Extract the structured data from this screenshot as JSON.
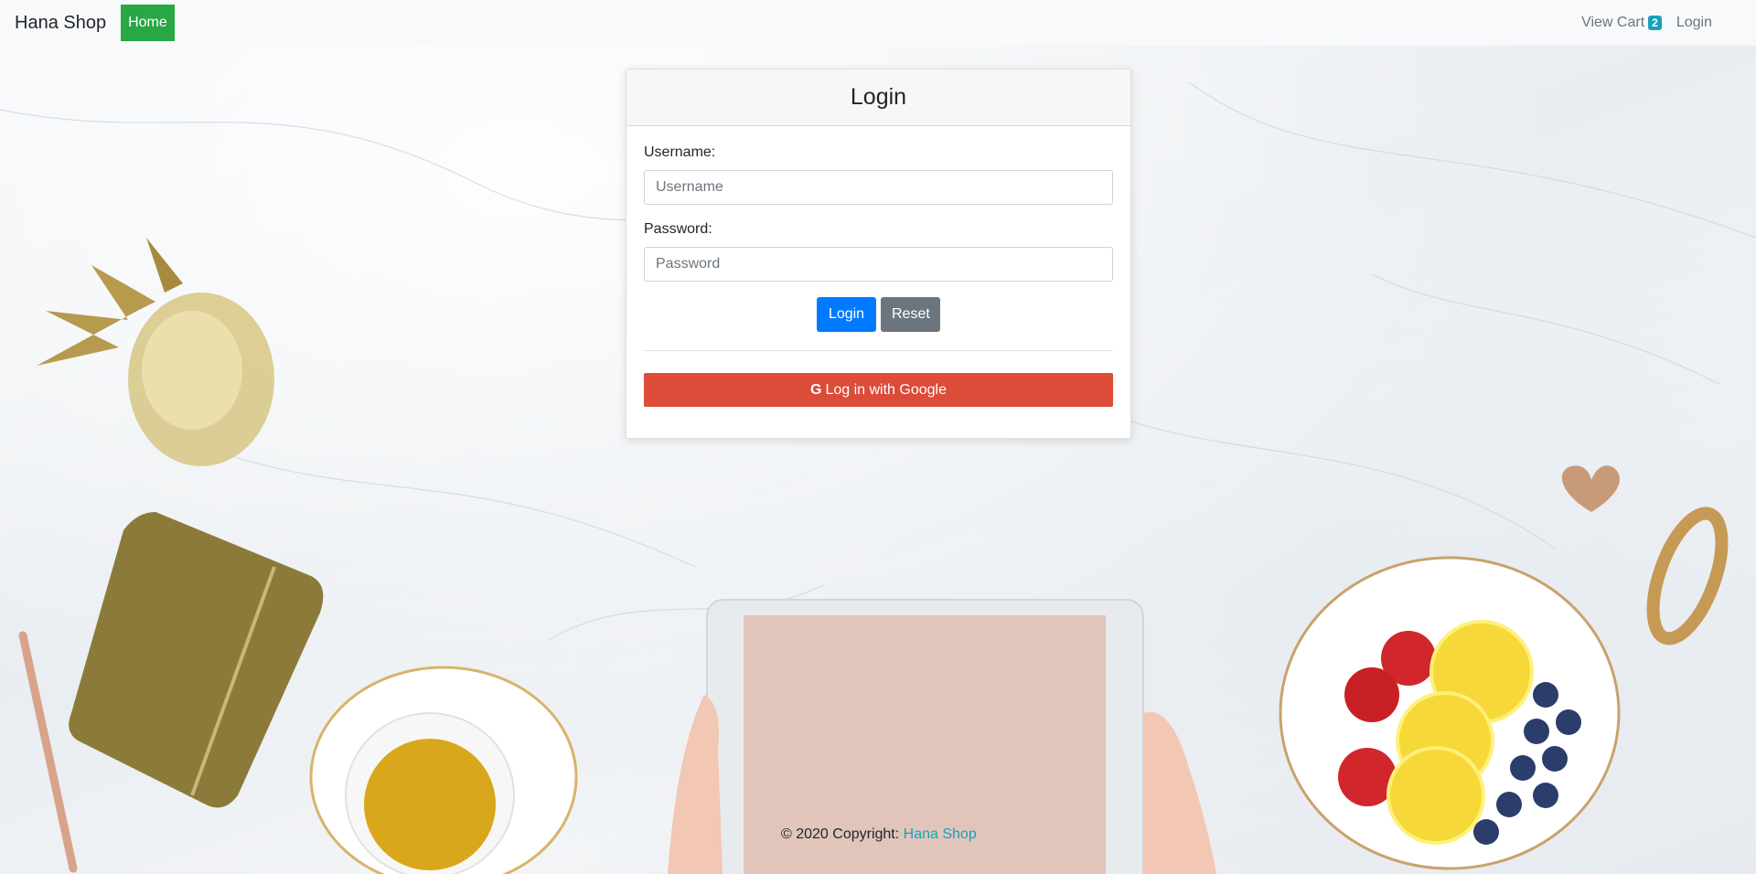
{
  "navbar": {
    "brand": "Hana Shop",
    "home_label": "Home",
    "view_cart_label": "View Cart",
    "cart_count": "2",
    "login_label": "Login"
  },
  "login_card": {
    "title": "Login",
    "username_label": "Username:",
    "username_placeholder": "Username",
    "username_value": "",
    "password_label": "Password:",
    "password_placeholder": "Password",
    "password_value": "",
    "login_button": "Login",
    "reset_button": "Reset",
    "google_icon": "G",
    "google_button": "Log in with Google"
  },
  "footer": {
    "copyright": "© 2020 Copyright:",
    "link": "Hana Shop"
  },
  "colors": {
    "home_green": "#28a745",
    "badge_teal": "#17a2b8",
    "primary_blue": "#007bff",
    "secondary_gray": "#6c757d",
    "google_red": "#dd4b39"
  },
  "icons": {
    "google": "google-icon"
  }
}
